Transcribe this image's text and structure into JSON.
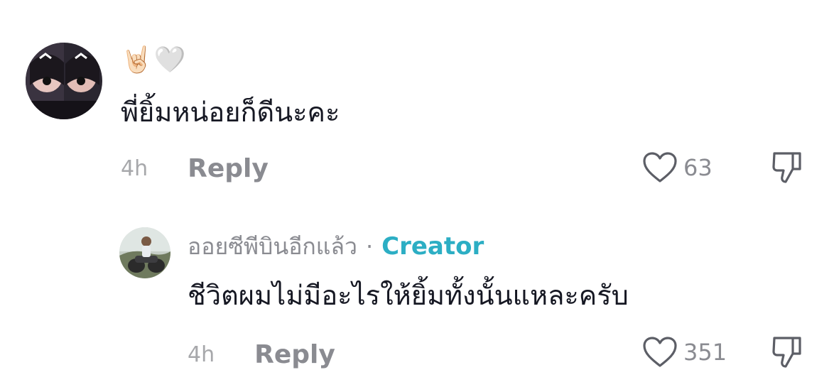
{
  "comments": [
    {
      "avatar": "user-avatar-girl",
      "emoji": [
        "🤘🏻",
        "🤍"
      ],
      "text": "พี่ยิ้มหน่อยก็ดีนะคะ",
      "time": "4h",
      "reply_label": "Reply",
      "like_count": "63"
    }
  ],
  "replies": [
    {
      "avatar": "creator-avatar-motorbike",
      "username": "ออยซีพีบินอีกแล้ว",
      "separator": "·",
      "badge": "Creator",
      "text": "ชีวิตผมไม่มีอะไรให้ยิ้มทั้งนั้นแหละครับ",
      "time": "4h",
      "reply_label": "Reply",
      "like_count": "351"
    }
  ],
  "colors": {
    "text": "#161823",
    "muted": "#8a8b91",
    "creator_badge": "#2caec4"
  },
  "icons": [
    "heart-outline-icon",
    "dislike-icon"
  ]
}
